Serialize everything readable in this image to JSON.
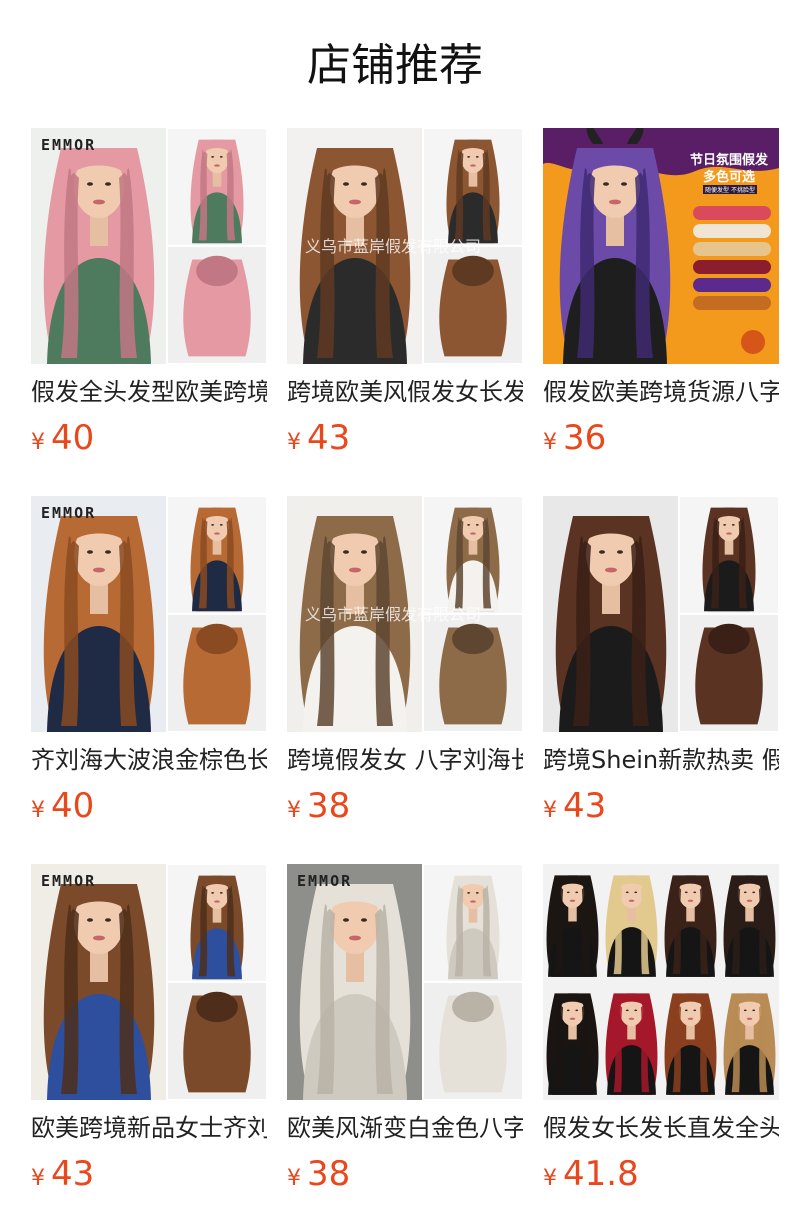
{
  "page": {
    "title": "店铺推荐"
  },
  "products": [
    {
      "name": "假发全头发型欧美跨境长直发",
      "currency": "¥",
      "price": "40",
      "brand_mark": "EMMOR",
      "watermark": "",
      "colors": {
        "bg": "#eef0ee",
        "hair": "#e59aa3",
        "hair_dark": "#c27884",
        "top": "#4e7a5e"
      }
    },
    {
      "name": "跨境欧美风假发女长发",
      "currency": "¥",
      "price": "43",
      "brand_mark": "",
      "watermark": "义乌市蓝岸假发有限公司",
      "colors": {
        "bg": "#f3f1ef",
        "hair": "#8c5632",
        "hair_dark": "#5f3a22",
        "top": "#2b2b2b"
      }
    },
    {
      "name": "假发欧美跨境货源八字刘海",
      "currency": "¥",
      "price": "36",
      "brand_mark": "",
      "watermark": "",
      "banner_line1": "节日氛围假发",
      "banner_line2": "多色可选",
      "banner_sub": "随便发型 不挑脸型",
      "colors": {
        "bg": "#f09a1f",
        "hair": "#6c4aa8",
        "hair_dark": "#3f2a72",
        "top": "#1e1e1e"
      }
    },
    {
      "name": "齐刘海大波浪金棕色长卷发",
      "currency": "¥",
      "price": "40",
      "brand_mark": "EMMOR",
      "watermark": "",
      "colors": {
        "bg": "#e9ecf0",
        "hair": "#b86a34",
        "hair_dark": "#8a4a22",
        "top": "#1f2a44"
      }
    },
    {
      "name": "跨境假发女 八字刘海长卷发",
      "currency": "¥",
      "price": "38",
      "brand_mark": "",
      "watermark": "义乌市蓝岸假发有限公司",
      "colors": {
        "bg": "#f1efec",
        "hair": "#8d6b49",
        "hair_dark": "#5e4630",
        "top": "#f4f2ee"
      }
    },
    {
      "name": "跨境Shein新款热卖 假发女",
      "currency": "¥",
      "price": "43",
      "brand_mark": "",
      "watermark": "",
      "colors": {
        "bg": "#e8e8e8",
        "hair": "#5a3322",
        "hair_dark": "#3a2016",
        "top": "#1b1b1b"
      }
    },
    {
      "name": "欧美跨境新品女士齐刘海长卷发",
      "currency": "¥",
      "price": "43",
      "brand_mark": "EMMOR",
      "watermark": "",
      "colors": {
        "bg": "#f0ede6",
        "hair": "#7a4a2a",
        "hair_dark": "#4e2e1a",
        "top": "#2d4f9e"
      }
    },
    {
      "name": "欧美风渐变白金色八字刘海",
      "currency": "¥",
      "price": "38",
      "brand_mark": "EMMOR",
      "watermark": "",
      "colors": {
        "bg": "#8e8f8a",
        "hair": "#e6e1d8",
        "hair_dark": "#b9b2a6",
        "top": "#cfcac0"
      }
    },
    {
      "name": "假发女长发长直发全头套",
      "currency": "¥",
      "price": "41.8",
      "brand_mark": "",
      "watermark": "",
      "swatches": [
        "#1c1613",
        "#e2c98e",
        "#3b2219",
        "#2a1d17",
        "#1a1412",
        "#a5182a",
        "#8a3f1f",
        "#b98b55"
      ],
      "colors": {
        "bg": "#f4f4f4",
        "hair": "#1c1613",
        "hair_dark": "#111111",
        "top": "#111111"
      }
    }
  ]
}
